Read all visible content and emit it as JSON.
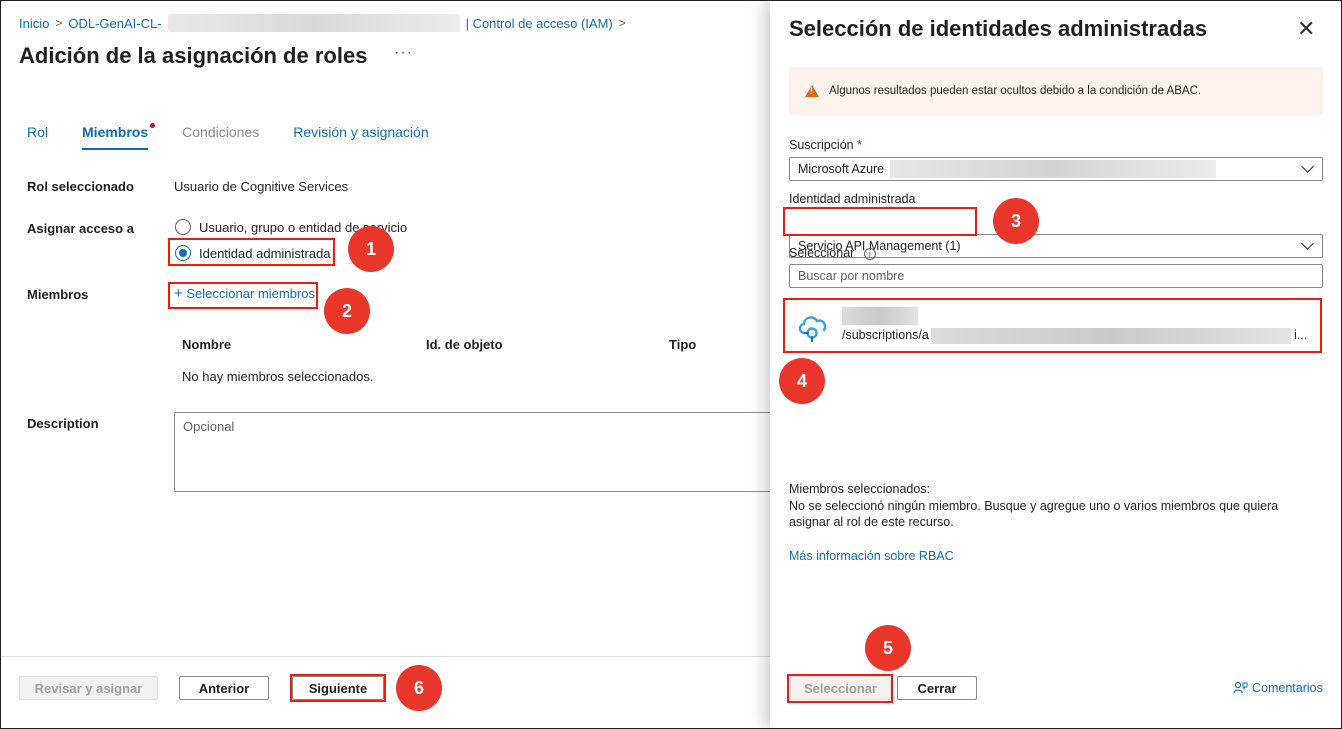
{
  "breadcrumb": {
    "home": "Inicio",
    "resource": "ODL-GenAI-CL-",
    "page": "| Control de acceso (IAM)"
  },
  "page": {
    "title": "Adición de la asignación de roles",
    "more": "···"
  },
  "tabs": [
    {
      "label": "Rol"
    },
    {
      "label": "Miembros"
    },
    {
      "label": "Condiciones"
    },
    {
      "label": "Revisión y asignación"
    }
  ],
  "form": {
    "selected_role_label": "Rol seleccionado",
    "selected_role_value": "Usuario de Cognitive Services",
    "assign_label": "Asignar acceso a",
    "option_user": "Usuario, grupo o entidad de servicio",
    "option_managed": "Identidad administrada",
    "members_label": "Miembros",
    "select_members": "Seleccionar miembros",
    "table_headers": [
      "Nombre",
      "Id. de objeto",
      "Tipo"
    ],
    "empty_members": "No hay miembros seleccionados.",
    "description_label": "Description",
    "description_placeholder": "Opcional"
  },
  "footer": {
    "review": "Revisar y asignar",
    "previous": "Anterior",
    "next": "Siguiente"
  },
  "panel": {
    "title": "Selección de identidades administradas",
    "warning": "Algunos resultados pueden estar ocultos debido a la condición de ABAC.",
    "subscription_label": "Suscripción",
    "required_mark": "*",
    "subscription_value": "Microsoft Azure",
    "managed_identity_label": "Identidad administrada",
    "managed_identity_value": "Servicio API Management (1)",
    "select_label": "Seleccionar",
    "search_placeholder": "Buscar por nombre",
    "result_path": "/subscriptions/a",
    "result_tail": "i...",
    "selected_members_title": "Miembros seleccionados:",
    "selected_members_text": "No se seleccionó ningún miembro. Busque y agregue uno o varios miembros que quiera asignar al rol de este recurso.",
    "rbac_link": "Más información sobre RBAC",
    "select_button": "Seleccionar",
    "close_button": "Cerrar",
    "feedback": "Comentarios"
  },
  "steps": [
    "1",
    "2",
    "3",
    "4",
    "5",
    "6"
  ],
  "colors": {
    "accent": "#0f6cbd",
    "callout_red": "#e8372a",
    "highlight_border": "#e81e12",
    "warning_bg": "#fdf2ec",
    "warning_icon": "#d36b1f"
  }
}
